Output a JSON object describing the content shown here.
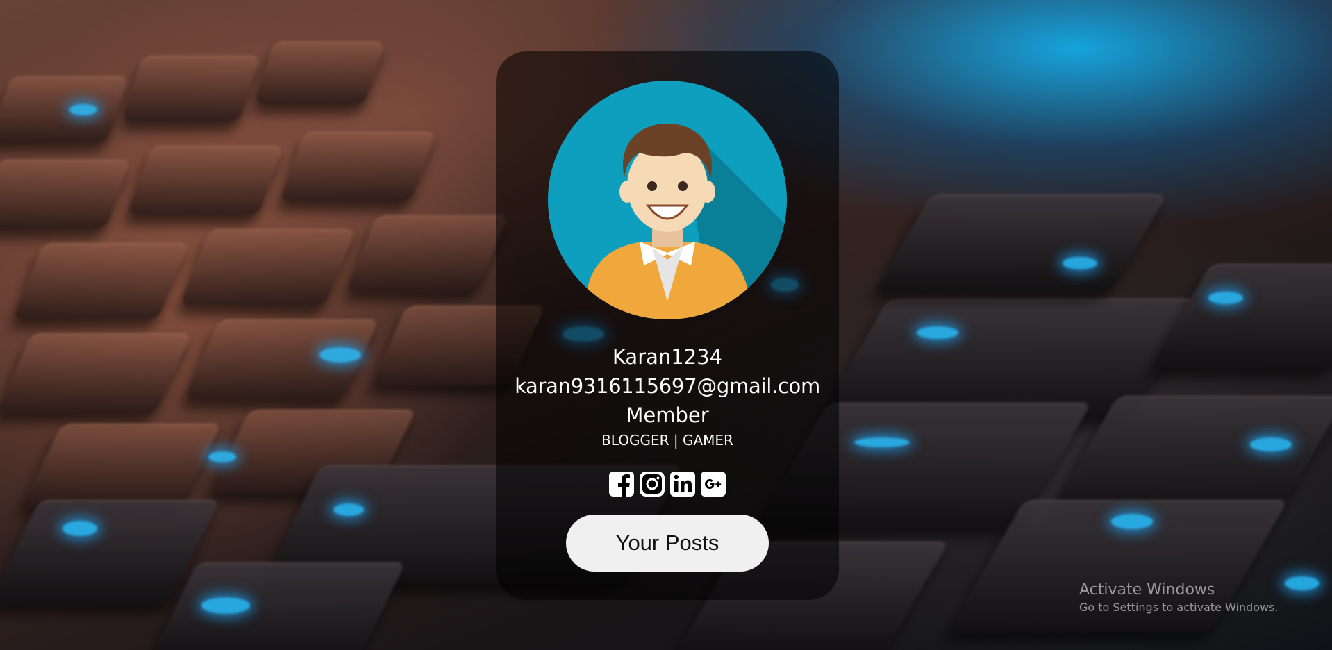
{
  "profile": {
    "username": "Karan1234",
    "email": "karan9316115697@gmail.com",
    "role": "Member",
    "tags": "BLOGGER | GAMER",
    "avatar_icon": "user-avatar-icon",
    "posts_button_label": "Your Posts"
  },
  "socials": [
    {
      "name": "Facebook",
      "icon": "facebook-icon"
    },
    {
      "name": "Instagram",
      "icon": "instagram-icon"
    },
    {
      "name": "LinkedIn",
      "icon": "linkedin-icon"
    },
    {
      "name": "Google Plus",
      "icon": "google-plus-icon"
    }
  ],
  "watermark": {
    "title": "Activate Windows",
    "subtitle": "Go to Settings to activate Windows."
  },
  "colors": {
    "avatar_bg": "#0e9fbe",
    "shirt": "#f0a73c",
    "hair": "#6b4226",
    "skin": "#f6d9b5",
    "button_bg": "#f0f0f0"
  }
}
